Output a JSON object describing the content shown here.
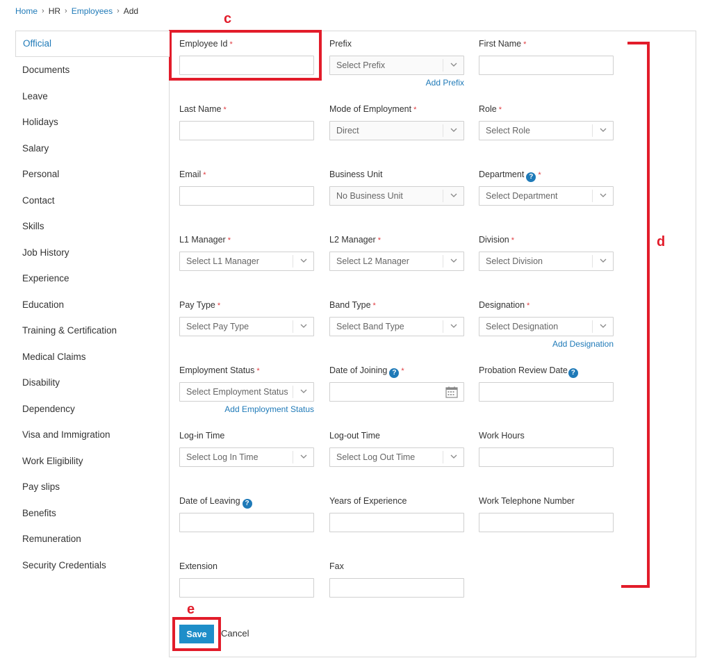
{
  "breadcrumb": {
    "home": "Home",
    "hr": "HR",
    "employees": "Employees",
    "add": "Add",
    "sep": "›"
  },
  "sidebar": {
    "items": [
      {
        "label": "Official"
      },
      {
        "label": "Documents"
      },
      {
        "label": "Leave"
      },
      {
        "label": "Holidays"
      },
      {
        "label": "Salary"
      },
      {
        "label": "Personal"
      },
      {
        "label": "Contact"
      },
      {
        "label": "Skills"
      },
      {
        "label": "Job History"
      },
      {
        "label": "Experience"
      },
      {
        "label": "Education"
      },
      {
        "label": "Training & Certification"
      },
      {
        "label": "Medical Claims"
      },
      {
        "label": "Disability"
      },
      {
        "label": "Dependency"
      },
      {
        "label": "Visa and Immigration"
      },
      {
        "label": "Work Eligibility"
      },
      {
        "label": "Pay slips"
      },
      {
        "label": "Benefits"
      },
      {
        "label": "Remuneration"
      },
      {
        "label": "Security Credentials"
      }
    ]
  },
  "form": {
    "employee_id": {
      "label": "Employee Id",
      "required": "*",
      "value": ""
    },
    "prefix": {
      "label": "Prefix",
      "value": "Select Prefix",
      "add": "Add Prefix"
    },
    "first_name": {
      "label": "First Name",
      "required": "*",
      "value": ""
    },
    "last_name": {
      "label": "Last Name",
      "required": "*",
      "value": ""
    },
    "mode_of_employment": {
      "label": "Mode of Employment",
      "required": "*",
      "value": "Direct"
    },
    "role": {
      "label": "Role",
      "required": "*",
      "value": "Select Role"
    },
    "email": {
      "label": "Email",
      "required": "*",
      "value": ""
    },
    "business_unit": {
      "label": "Business Unit",
      "value": "No Business Unit"
    },
    "department": {
      "label": "Department",
      "required": "*",
      "value": "Select Department"
    },
    "l1_manager": {
      "label": "L1 Manager",
      "required": "*",
      "value": "Select L1 Manager"
    },
    "l2_manager": {
      "label": "L2 Manager",
      "required": "*",
      "value": "Select L2 Manager"
    },
    "division": {
      "label": "Division",
      "required": "*",
      "value": "Select Division"
    },
    "pay_type": {
      "label": "Pay Type",
      "required": "*",
      "value": "Select Pay Type"
    },
    "band_type": {
      "label": "Band Type",
      "required": "*",
      "value": "Select Band Type"
    },
    "designation": {
      "label": "Designation",
      "required": "*",
      "value": "Select Designation",
      "add": "Add Designation"
    },
    "employment_status": {
      "label": "Employment Status",
      "required": "*",
      "value": "Select Employment Status",
      "add": "Add Employment Status"
    },
    "date_of_joining": {
      "label": "Date of Joining",
      "required": "*",
      "value": ""
    },
    "probation_review_date": {
      "label": "Probation Review Date",
      "value": ""
    },
    "login_time": {
      "label": "Log-in Time",
      "value": "Select Log In Time"
    },
    "logout_time": {
      "label": "Log-out Time",
      "value": "Select Log Out Time"
    },
    "work_hours": {
      "label": "Work Hours",
      "value": ""
    },
    "date_of_leaving": {
      "label": "Date of Leaving",
      "value": ""
    },
    "years_of_experience": {
      "label": "Years of Experience",
      "value": ""
    },
    "work_telephone": {
      "label": "Work Telephone Number",
      "value": ""
    },
    "extension": {
      "label": "Extension",
      "value": ""
    },
    "fax": {
      "label": "Fax",
      "value": ""
    }
  },
  "help_glyph": "?",
  "actions": {
    "save": "Save",
    "cancel": "Cancel"
  },
  "annotations": {
    "c": "c",
    "d": "d",
    "e": "e"
  },
  "colors": {
    "link": "#1f7ab8",
    "save_button": "#1e8ec9",
    "required": "#e0393e",
    "annotation": "#e21c2a"
  }
}
